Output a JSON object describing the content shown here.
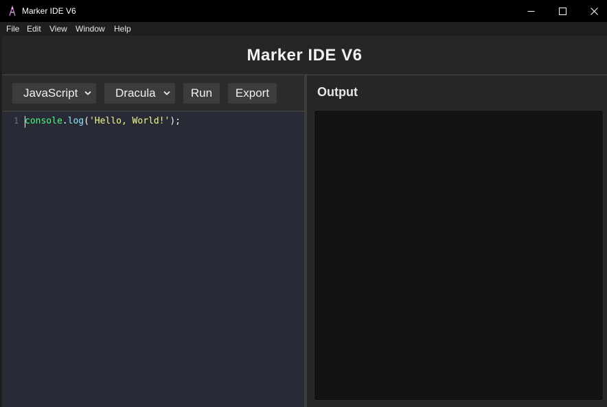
{
  "window": {
    "title": "Marker IDE V6",
    "controls": [
      "minimize-icon",
      "maximize-icon",
      "close-icon"
    ]
  },
  "menu": {
    "items": [
      {
        "label": "File"
      },
      {
        "label": "Edit"
      },
      {
        "label": "View"
      },
      {
        "label": "Window"
      },
      {
        "label": "Help"
      }
    ]
  },
  "header": {
    "title": "Marker IDE V6"
  },
  "toolbar": {
    "language": "JavaScript",
    "theme": "Dracula",
    "run_label": "Run",
    "export_label": "Export"
  },
  "editor": {
    "line_number": "1",
    "tokens": {
      "object": "console",
      "dot": ".",
      "method": "log",
      "open": "(",
      "string": "'Hello, World!'",
      "close": ");"
    }
  },
  "output": {
    "title": "Output",
    "content": ""
  },
  "colors": {
    "editor_bg": "#282a36",
    "token_object": "#50fa7b",
    "token_method": "#8be9fd",
    "token_string": "#f1fa8c",
    "panel_bg": "#262626",
    "output_bg": "#131313"
  }
}
